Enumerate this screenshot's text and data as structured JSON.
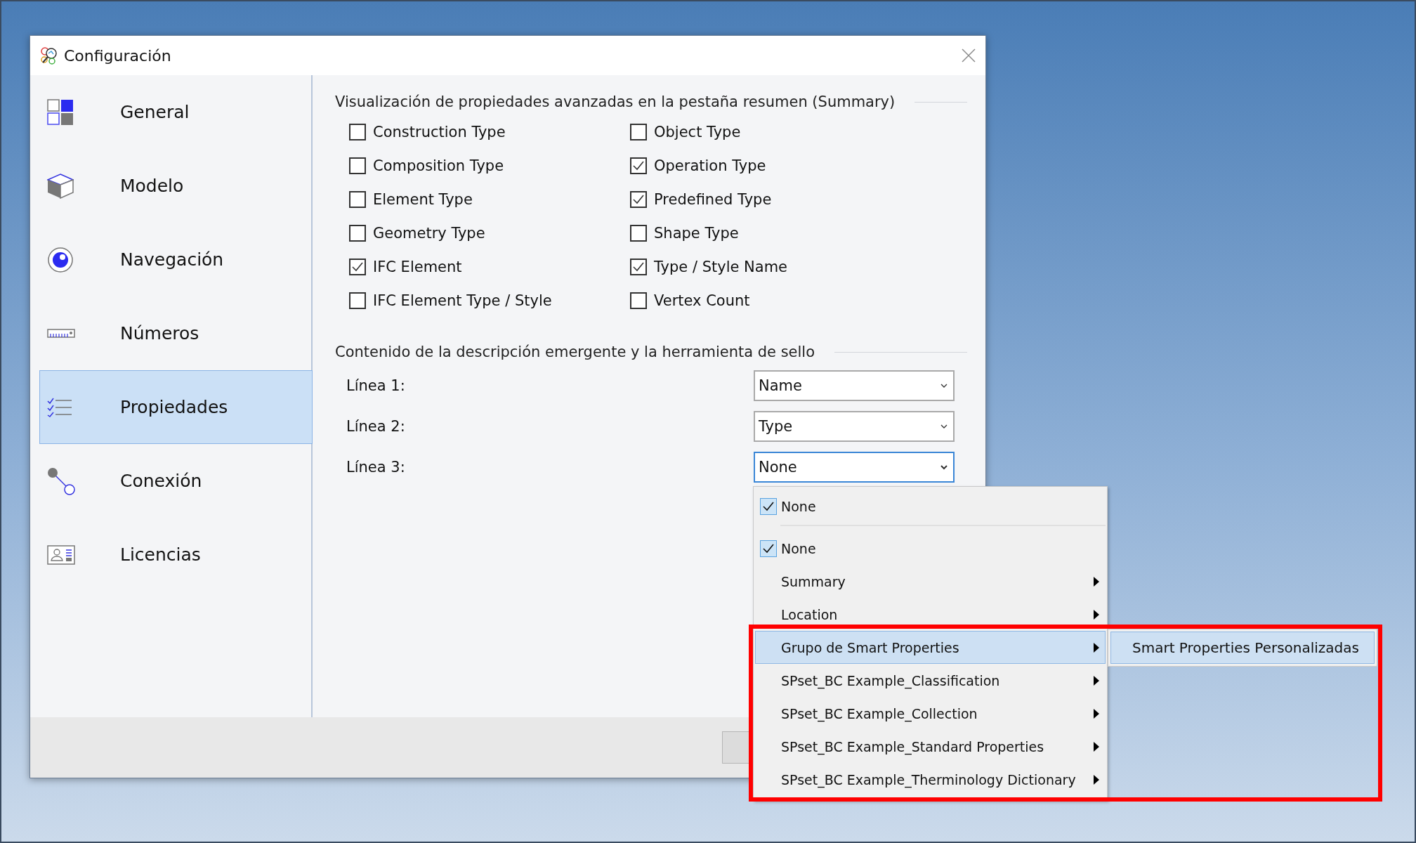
{
  "window": {
    "title": "Configuración"
  },
  "sidebar": {
    "items": [
      {
        "label": "General",
        "selected": false
      },
      {
        "label": "Modelo",
        "selected": false
      },
      {
        "label": "Navegación",
        "selected": false
      },
      {
        "label": "Números",
        "selected": false
      },
      {
        "label": "Propiedades",
        "selected": true
      },
      {
        "label": "Conexión",
        "selected": false
      },
      {
        "label": "Licencias",
        "selected": false
      }
    ]
  },
  "summary_section": {
    "title": "Visualización de propiedades avanzadas en la pestaña resumen (Summary)",
    "checkboxes": [
      {
        "label": "Construction Type",
        "checked": false
      },
      {
        "label": "Object Type",
        "checked": false
      },
      {
        "label": "Composition Type",
        "checked": false
      },
      {
        "label": "Operation Type",
        "checked": true
      },
      {
        "label": "Element Type",
        "checked": false
      },
      {
        "label": "Predefined Type",
        "checked": true
      },
      {
        "label": "Geometry Type",
        "checked": false
      },
      {
        "label": "Shape Type",
        "checked": false
      },
      {
        "label": "IFC Element",
        "checked": true
      },
      {
        "label": "Type / Style Name",
        "checked": true
      },
      {
        "label": "IFC Element Type / Style",
        "checked": false
      },
      {
        "label": "Vertex Count",
        "checked": false
      }
    ]
  },
  "tooltip_section": {
    "title": "Contenido de la descripción emergente y la herramienta de sello",
    "lines": [
      {
        "label": "Línea 1:",
        "value": "Name",
        "open": false
      },
      {
        "label": "Línea 2:",
        "value": "Type",
        "open": false
      },
      {
        "label": "Línea 3:",
        "value": "None",
        "open": true
      }
    ]
  },
  "dropdown_menu": {
    "items": [
      {
        "kind": "check",
        "label": "None",
        "checked": true
      },
      {
        "kind": "separator"
      },
      {
        "kind": "check",
        "label": "None",
        "checked": true
      },
      {
        "kind": "submenu",
        "label": "Summary",
        "selected": false
      },
      {
        "kind": "submenu",
        "label": "Location",
        "selected": false
      },
      {
        "kind": "submenu",
        "label": "Grupo de Smart Properties",
        "selected": true
      },
      {
        "kind": "submenu",
        "label": "SPset_BC Example_Classification",
        "selected": false
      },
      {
        "kind": "submenu",
        "label": "SPset_BC Example_Collection",
        "selected": false
      },
      {
        "kind": "submenu",
        "label": "SPset_BC Example_Standard Properties",
        "selected": false
      },
      {
        "kind": "submenu",
        "label": "SPset_BC Example_Therminology Dictionary",
        "selected": false
      }
    ]
  },
  "submenu": {
    "items": [
      {
        "label": "Smart Properties Personalizadas",
        "selected": true
      }
    ]
  }
}
